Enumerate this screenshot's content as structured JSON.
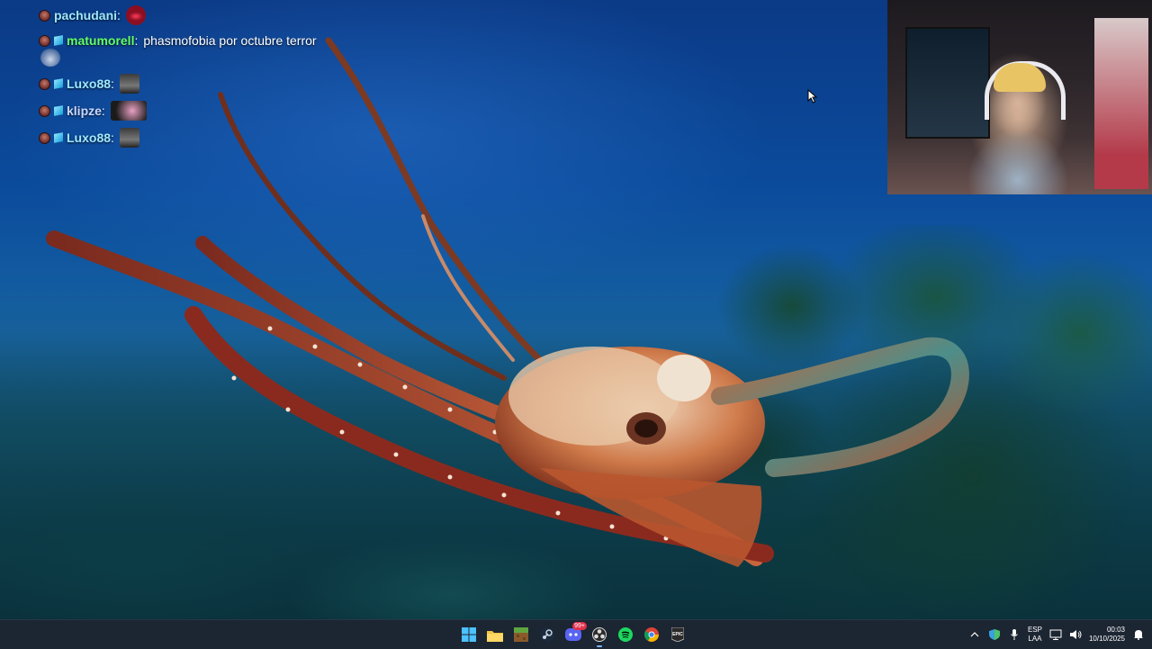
{
  "chat": {
    "messages": [
      {
        "user": "pachudani",
        "user_color": "#9ee8ff",
        "badges": [
          "round"
        ],
        "text": "",
        "emote": "lips-emote"
      },
      {
        "user": "matumorell",
        "user_color": "#66ff66",
        "badges": [
          "round",
          "cube"
        ],
        "text": "phasmofobia por octubre terror",
        "emote": "cloud-emote"
      },
      {
        "user": "Luxo88",
        "user_color": "#9ee8ff",
        "badges": [
          "round",
          "cube"
        ],
        "text": "",
        "emote": "face-emote"
      },
      {
        "user": "klipze",
        "user_color": "#c9d8ff",
        "badges": [
          "round",
          "cube"
        ],
        "text": "",
        "emote": "wide-emote"
      },
      {
        "user": "Luxo88",
        "user_color": "#9ee8ff",
        "badges": [
          "round",
          "cube"
        ],
        "text": "",
        "emote": "face-emote"
      }
    ]
  },
  "taskbar": {
    "apps": [
      {
        "name": "start-icon",
        "active": false
      },
      {
        "name": "file-explorer-icon",
        "active": false
      },
      {
        "name": "minecraft-icon",
        "active": false
      },
      {
        "name": "steam-icon",
        "active": false
      },
      {
        "name": "discord-icon",
        "active": false,
        "badge": "99+"
      },
      {
        "name": "obs-icon",
        "active": true
      },
      {
        "name": "spotify-icon",
        "active": false
      },
      {
        "name": "chrome-icon",
        "active": false
      },
      {
        "name": "epic-games-icon",
        "active": false
      }
    ],
    "tray": {
      "language_top": "ESP",
      "language_bottom": "LAA",
      "time": "00:03",
      "date": "10/10/2025"
    }
  },
  "colors": {
    "taskbar_bg": "#1c2532",
    "accent": "#7fb6ff"
  }
}
